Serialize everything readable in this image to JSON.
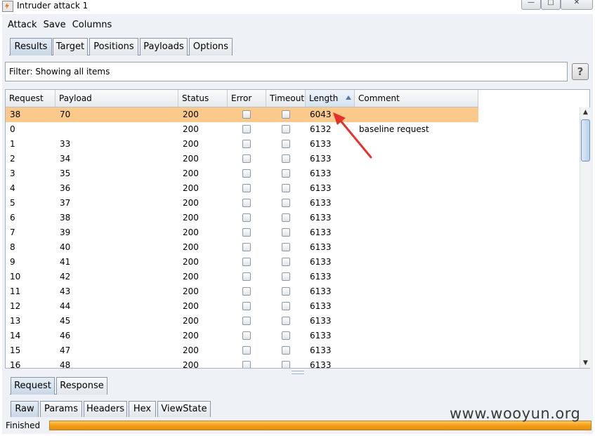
{
  "window": {
    "title": "Intruder attack 1"
  },
  "menu": [
    "Attack",
    "Save",
    "Columns"
  ],
  "tabs": [
    {
      "label": "Results",
      "active": true
    },
    {
      "label": "Target",
      "active": false
    },
    {
      "label": "Positions",
      "active": false
    },
    {
      "label": "Payloads",
      "active": false
    },
    {
      "label": "Options",
      "active": false
    }
  ],
  "filter": {
    "text": "Filter: Showing all items",
    "help_label": "?"
  },
  "table": {
    "columns": [
      "Request",
      "Payload",
      "Status",
      "Error",
      "Timeout",
      "Length",
      "Comment"
    ],
    "sorted_column": "Length",
    "rows": [
      {
        "request": "38",
        "payload": "70",
        "status": "200",
        "length": "6043",
        "comment": "",
        "selected": true
      },
      {
        "request": "0",
        "payload": "",
        "status": "200",
        "length": "6132",
        "comment": "baseline request",
        "selected": false
      },
      {
        "request": "1",
        "payload": "33",
        "status": "200",
        "length": "6133",
        "comment": "",
        "selected": false
      },
      {
        "request": "2",
        "payload": "34",
        "status": "200",
        "length": "6133",
        "comment": "",
        "selected": false
      },
      {
        "request": "3",
        "payload": "35",
        "status": "200",
        "length": "6133",
        "comment": "",
        "selected": false
      },
      {
        "request": "4",
        "payload": "36",
        "status": "200",
        "length": "6133",
        "comment": "",
        "selected": false
      },
      {
        "request": "5",
        "payload": "37",
        "status": "200",
        "length": "6133",
        "comment": "",
        "selected": false
      },
      {
        "request": "6",
        "payload": "38",
        "status": "200",
        "length": "6133",
        "comment": "",
        "selected": false
      },
      {
        "request": "7",
        "payload": "39",
        "status": "200",
        "length": "6133",
        "comment": "",
        "selected": false
      },
      {
        "request": "8",
        "payload": "40",
        "status": "200",
        "length": "6133",
        "comment": "",
        "selected": false
      },
      {
        "request": "9",
        "payload": "41",
        "status": "200",
        "length": "6133",
        "comment": "",
        "selected": false
      },
      {
        "request": "10",
        "payload": "42",
        "status": "200",
        "length": "6133",
        "comment": "",
        "selected": false
      },
      {
        "request": "11",
        "payload": "43",
        "status": "200",
        "length": "6133",
        "comment": "",
        "selected": false
      },
      {
        "request": "12",
        "payload": "44",
        "status": "200",
        "length": "6133",
        "comment": "",
        "selected": false
      },
      {
        "request": "13",
        "payload": "45",
        "status": "200",
        "length": "6133",
        "comment": "",
        "selected": false
      },
      {
        "request": "14",
        "payload": "46",
        "status": "200",
        "length": "6133",
        "comment": "",
        "selected": false
      },
      {
        "request": "15",
        "payload": "47",
        "status": "200",
        "length": "6133",
        "comment": "",
        "selected": false
      },
      {
        "request": "16",
        "payload": "48",
        "status": "200",
        "length": "6133",
        "comment": "",
        "selected": false
      }
    ]
  },
  "detail_tabs": [
    {
      "label": "Request",
      "active": true
    },
    {
      "label": "Response",
      "active": false
    }
  ],
  "view_tabs": [
    {
      "label": "Raw",
      "active": true
    },
    {
      "label": "Params",
      "active": false
    },
    {
      "label": "Headers",
      "active": false
    },
    {
      "label": "Hex",
      "active": false
    },
    {
      "label": "ViewState",
      "active": false
    }
  ],
  "status": {
    "text": "Finished",
    "progress": 1.0
  },
  "watermark": "www.wooyun.org",
  "colors": {
    "selected_row": "#fbc98a",
    "progress": "#f39c12",
    "annotation_arrow": "#e8302a"
  }
}
